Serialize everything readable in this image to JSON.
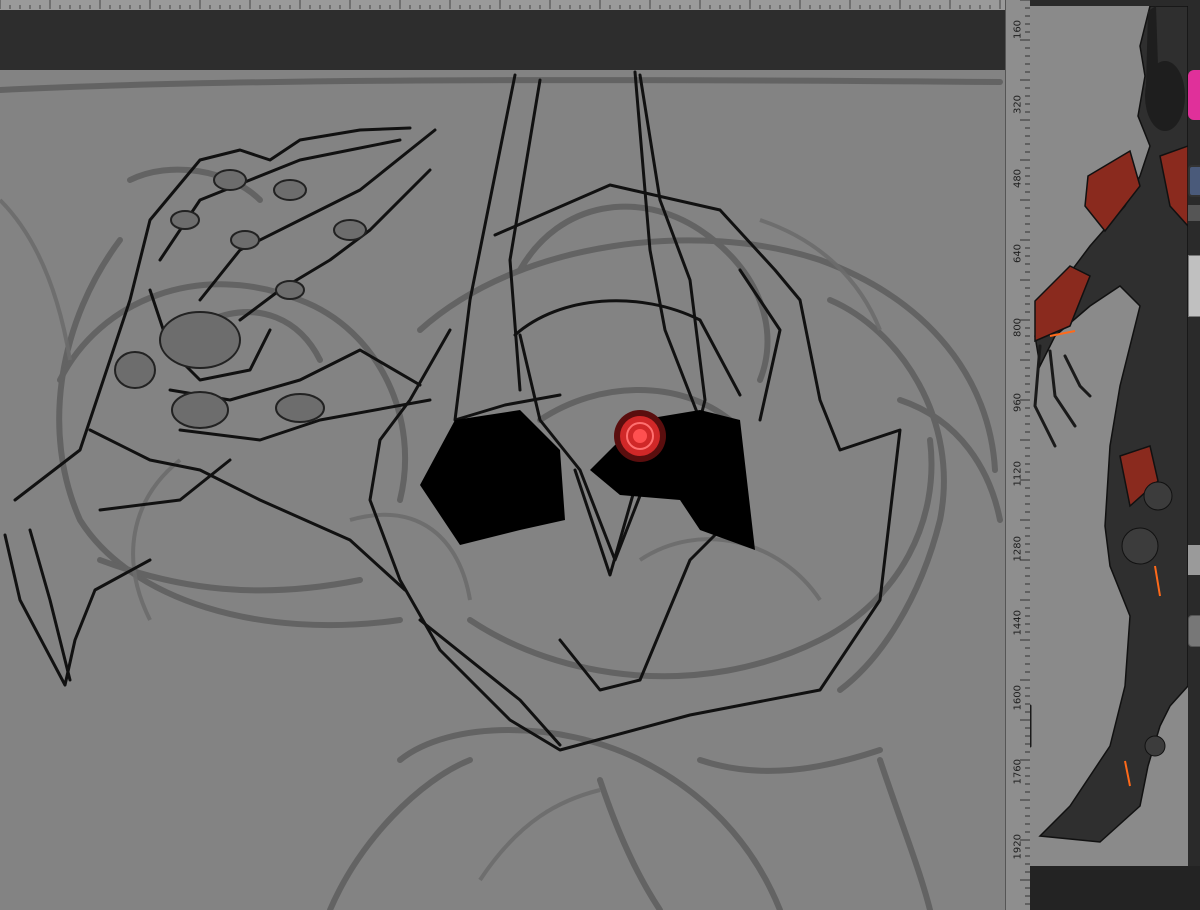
{
  "app": {
    "canvas_bg": "#838383",
    "chrome_bg": "#2d2d2d",
    "accent_eye": "#e03030",
    "armor_red": "#8a2a1e",
    "glow_orange": "#ff6a1a",
    "tool_pink": "#e0309a"
  },
  "ruler": {
    "labels": [
      "160",
      "320",
      "480",
      "640",
      "800",
      "960",
      "1120",
      "1280",
      "1440",
      "1600",
      "1760",
      "1920"
    ]
  },
  "reference": {
    "name": "character-reference"
  },
  "tools": {
    "icons": [
      "color-swatch-icon",
      "layer-icon",
      "brush-icon",
      "link-icon",
      "panel-icon",
      "lock-icon"
    ]
  }
}
